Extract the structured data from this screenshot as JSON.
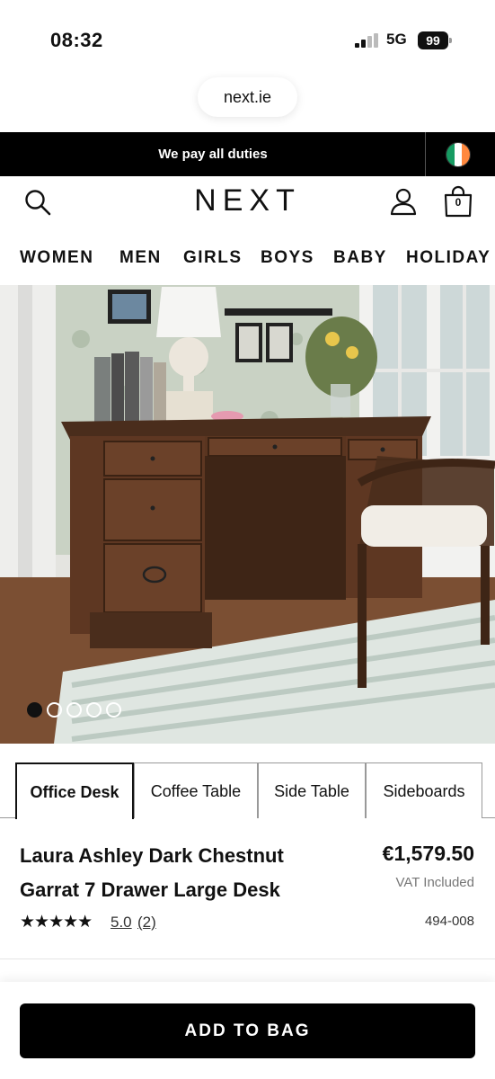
{
  "status": {
    "time": "08:32",
    "network": "5G",
    "battery": "99"
  },
  "browser": {
    "url": "next.ie"
  },
  "promo": {
    "text": "We pay all duties",
    "flag_colors": [
      "#169b62",
      "#ffffff",
      "#ff883e"
    ]
  },
  "header": {
    "logo": "NEXT",
    "bag_count": "0"
  },
  "nav": {
    "items": [
      "WOMEN",
      "MEN",
      "GIRLS",
      "BOYS",
      "BABY",
      "HOLIDAY"
    ]
  },
  "gallery": {
    "image_count": 5,
    "active_index": 0,
    "description_icon": "product-photo"
  },
  "tabs": [
    {
      "label": "Office Desk",
      "active": true
    },
    {
      "label": "Coffee Table",
      "active": false
    },
    {
      "label": "Side Table",
      "active": false
    },
    {
      "label": "Sideboards",
      "active": false
    }
  ],
  "product": {
    "title_line1": "Laura Ashley Dark Chestnut",
    "title_line2": "Garrat 7 Drawer Large Desk",
    "price": "€1,579.50",
    "vat": "VAT Included",
    "stars": "★★★★★",
    "rating": "5.0",
    "review_count": "(2)",
    "sku": "494-008"
  },
  "actions": {
    "add_to_bag": "ADD TO BAG"
  },
  "colors": {
    "black": "#000000",
    "accent_text": "#111111",
    "muted": "#777777"
  }
}
